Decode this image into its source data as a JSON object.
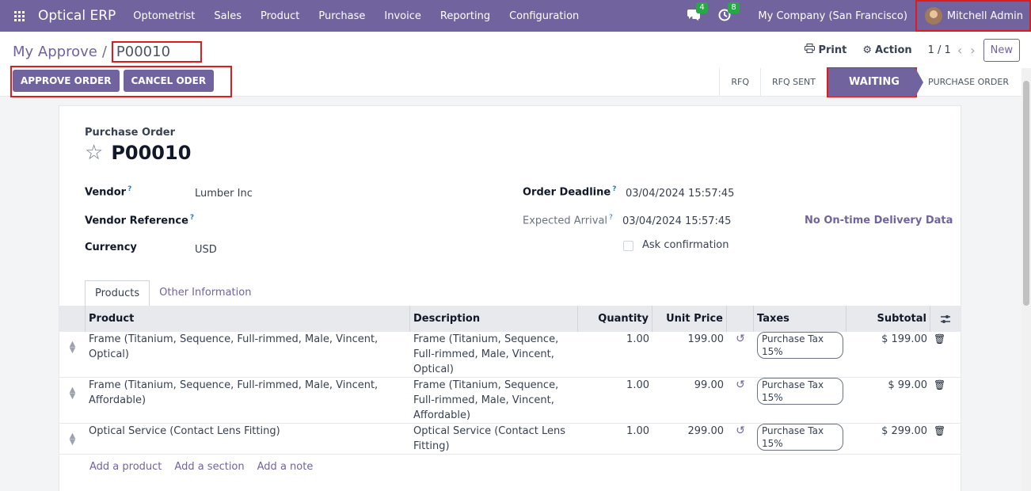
{
  "navbar": {
    "brand": "Optical ERP",
    "menu": [
      "Optometrist",
      "Sales",
      "Product",
      "Purchase",
      "Invoice",
      "Reporting",
      "Configuration"
    ],
    "messages_count": "4",
    "activities_count": "8",
    "company": "My Company (San Francisco)",
    "user": "Mitchell Admin"
  },
  "breadcrumb": {
    "parent": "My Approve",
    "separator": "/",
    "current": "P00010"
  },
  "control": {
    "print_label": "Print",
    "action_label": "Action",
    "pager": "1 / 1",
    "new_label": "New"
  },
  "buttons": {
    "approve": "APPROVE ORDER",
    "cancel": "CANCEL ODER"
  },
  "statusbar": {
    "rfq": "RFQ",
    "rfq_sent": "RFQ SENT",
    "waiting": "WAITING",
    "purchase_order": "PURCHASE ORDER"
  },
  "form": {
    "doc_type": "Purchase Order",
    "name": "P00010",
    "vendor_label": "Vendor",
    "vendor_value": "Lumber Inc",
    "vendor_ref_label": "Vendor Reference",
    "vendor_ref_value": "",
    "currency_label": "Currency",
    "currency_value": "USD",
    "deadline_label": "Order Deadline",
    "deadline_value": "03/04/2024 15:57:45",
    "arrival_label": "Expected Arrival",
    "arrival_value": "03/04/2024 15:57:45",
    "ontime": "No On-time Delivery Data",
    "ask_confirmation": "Ask confirmation",
    "help_mark": "?"
  },
  "tabs": {
    "products": "Products",
    "other": "Other Information"
  },
  "table": {
    "headers": {
      "product": "Product",
      "description": "Description",
      "quantity": "Quantity",
      "unit_price": "Unit Price",
      "taxes": "Taxes",
      "subtotal": "Subtotal"
    },
    "rows": [
      {
        "product": "Frame (Titanium, Sequence, Full-rimmed, Male, Vincent, Optical)",
        "description": "Frame (Titanium, Sequence, Full-rimmed, Male, Vincent, Optical)",
        "quantity": "1.00",
        "unit_price": "199.00",
        "tax": "Purchase Tax 15%",
        "subtotal": "$ 199.00"
      },
      {
        "product": "Frame (Titanium, Sequence, Full-rimmed, Male, Vincent, Affordable)",
        "description": "Frame (Titanium, Sequence, Full-rimmed, Male, Vincent, Affordable)",
        "quantity": "1.00",
        "unit_price": "99.00",
        "tax": "Purchase Tax 15%",
        "subtotal": "$ 99.00"
      },
      {
        "product": "Optical Service (Contact Lens Fitting)",
        "description": "Optical Service (Contact Lens Fitting)",
        "quantity": "1.00",
        "unit_price": "299.00",
        "tax": "Purchase Tax 15%",
        "subtotal": "$ 299.00"
      }
    ],
    "add_product": "Add a product",
    "add_section": "Add a section",
    "add_note": "Add a note"
  },
  "colors": {
    "brand": "#71639e",
    "highlight": "#e01b1b",
    "badge": "#28a745"
  }
}
